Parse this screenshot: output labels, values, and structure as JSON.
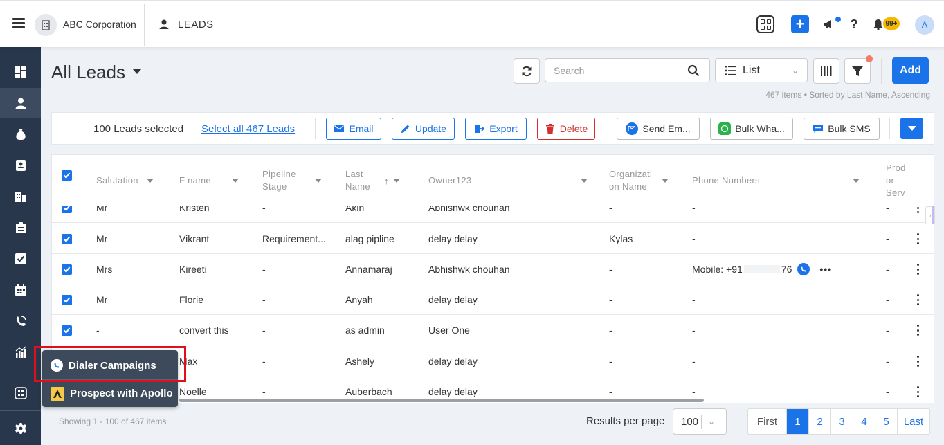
{
  "header": {
    "company_name": "ABC Corporation",
    "module_title": "LEADS",
    "notifications_badge": "99+",
    "avatar_initial": "A"
  },
  "sidebar": {
    "items": [
      "dashboard-icon",
      "leads-icon",
      "deals-icon",
      "contacts-icon",
      "companies-icon",
      "products-icon",
      "tasks-icon",
      "calendar-icon",
      "calls-icon",
      "reports-icon",
      "apps-icon",
      "settings-icon"
    ],
    "active": "leads-icon"
  },
  "page": {
    "title": "All Leads",
    "search_placeholder": "Search",
    "view_label": "List",
    "add_label": "Add",
    "items_meta": "467 items • Sorted by Last Name, Ascending"
  },
  "bulk": {
    "selected_count": "100 Leads selected",
    "select_all": "Select all 467 Leads",
    "email": "Email",
    "update": "Update",
    "export": "Export",
    "delete": "Delete",
    "send_email": "Send Em...",
    "bulk_whatsapp": "Bulk Wha...",
    "bulk_sms": "Bulk SMS"
  },
  "table": {
    "columns": {
      "salutation": "Salutation",
      "fname": "F name",
      "pipeline_stage": "Pipeline Stage",
      "last_name": "Last Name",
      "owner": "Owner123",
      "org_name": "Organizati on Name",
      "phone": "Phone Numbers",
      "product": "Prod or Serv"
    },
    "rows": [
      {
        "salutation": "Mr",
        "fname": "Kristen",
        "pipeline": "-",
        "last": "Akin",
        "owner": "Abhishwk chouhan",
        "org": "-",
        "phone": "-",
        "product": "-"
      },
      {
        "salutation": "Mr",
        "fname": "Vikrant",
        "pipeline": "Requirement...",
        "last": "alag pipline",
        "owner": "delay delay",
        "org": "Kylas",
        "phone": "-",
        "product": "-"
      },
      {
        "salutation": "Mrs",
        "fname": "Kireeti",
        "pipeline": "-",
        "last": "Annamaraj",
        "owner": "Abhishwk chouhan",
        "org": "-",
        "phone": "Mobile: +91",
        "phone_suffix": "76",
        "product": "-"
      },
      {
        "salutation": "Mr",
        "fname": "Florie",
        "pipeline": "-",
        "last": "Anyah",
        "owner": "delay delay",
        "org": "-",
        "phone": "-",
        "product": "-"
      },
      {
        "salutation": "-",
        "fname": "convert this",
        "pipeline": "-",
        "last": "as admin",
        "owner": "User One",
        "org": "-",
        "phone": "-",
        "product": "-"
      },
      {
        "salutation": "",
        "fname": "Max",
        "pipeline": "-",
        "last": "Ashely",
        "owner": "delay delay",
        "org": "-",
        "phone": "-",
        "product": "-"
      },
      {
        "salutation": "",
        "fname": "Noelle",
        "pipeline": "-",
        "last": "Auberbach",
        "owner": "delay delay",
        "org": "-",
        "phone": "-",
        "product": "-"
      }
    ]
  },
  "footer": {
    "showing": "Showing 1 - 100 of 467 items",
    "rpp_label": "Results per page",
    "rpp_value": "100",
    "pages": {
      "first": "First",
      "p1": "1",
      "p2": "2",
      "p3": "3",
      "p4": "4",
      "p5": "5",
      "last": "Last"
    }
  },
  "popup": {
    "dialer": "Dialer Campaigns",
    "apollo": "Prospect with Apollo"
  },
  "colors": {
    "accent": "#1a73e8",
    "sidebar": "#28374b",
    "danger": "#d32f2f",
    "highlight": "#e0101a"
  }
}
